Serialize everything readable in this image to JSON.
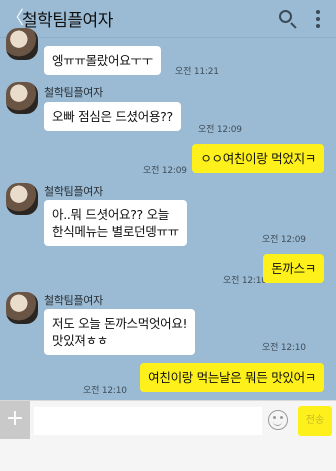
{
  "header": {
    "back": "〈",
    "title": "철학팀플여자"
  },
  "messages": [
    {
      "text": "엥ㅠㅠ몰랐어요ㅜㅜ",
      "time": "오전 11:21"
    },
    {
      "sender": "철학팀플여자",
      "text": "오빠 점심은 드셨어용??",
      "time": "오전 12:09"
    },
    {
      "text": "ㅇㅇ여친이랑 먹었지ㅋ",
      "time": "오전 12:09"
    },
    {
      "sender": "철학팀플여자",
      "line1": "아..뭐 드셧어요?? 오늘",
      "line2": "한식메뉴는 별로던뎅ㅠㅠ",
      "time": "오전 12:09"
    },
    {
      "text": "돈까스ㅋ",
      "time": "오전 12:10"
    },
    {
      "sender": "철학팀플여자",
      "line1": "저도 오늘 돈까스먹엇어요!",
      "line2": "맛있져ㅎㅎ",
      "time": "오전 12:10"
    },
    {
      "text": "여친이랑 먹는날은 뭐든 맛있어ㅋ",
      "time": "오전 12:10"
    }
  ],
  "input": {
    "plus": "+",
    "send": "전송"
  },
  "colors": {
    "background": "#9bbbd4",
    "my_bubble": "#fef01b",
    "their_bubble": "#ffffff"
  }
}
